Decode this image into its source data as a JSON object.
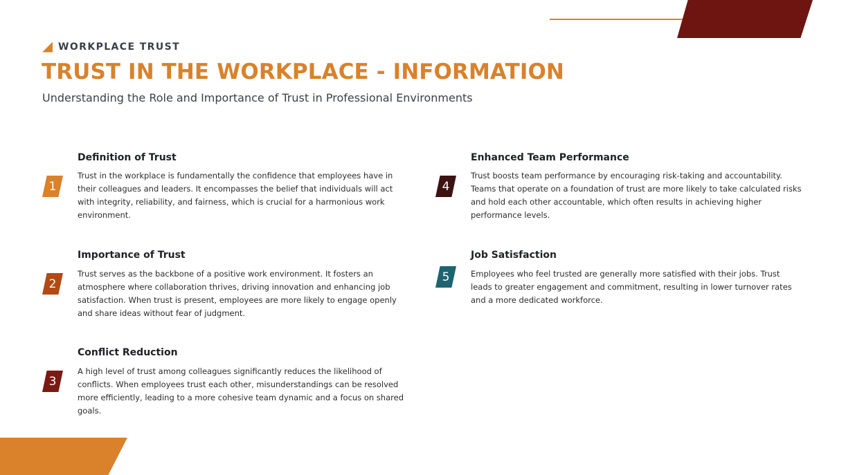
{
  "header": {
    "eyebrow": "WORKPLACE TRUST",
    "title": "TRUST IN THE WORKPLACE - INFORMATION",
    "subtitle": "Understanding the Role and Importance of Trust in Professional Environments"
  },
  "colors": {
    "orange": "#d9822b",
    "dark_red": "#6e1511",
    "rust": "#b24a14",
    "maroon": "#7a1a14",
    "dark_brown": "#3d1312",
    "teal": "#1d6470"
  },
  "items": [
    {
      "number": "1",
      "heading": "Definition of Trust",
      "body": "Trust in the workplace is fundamentally the confidence that employees have in their colleagues and leaders. It encompasses the belief that individuals will act with integrity, reliability, and fairness, which is crucial for a harmonious work environment."
    },
    {
      "number": "2",
      "heading": "Importance of Trust",
      "body": "Trust serves as the backbone of a positive work environment. It fosters an atmosphere where collaboration thrives, driving innovation and enhancing job satisfaction. When trust is present, employees are more likely to engage openly and share ideas without fear of judgment."
    },
    {
      "number": "3",
      "heading": "Conflict Reduction",
      "body": "A high level of trust among colleagues significantly reduces the likelihood of conflicts. When employees trust each other, misunderstandings can be resolved more efficiently, leading to a more cohesive team dynamic and a focus on shared goals."
    },
    {
      "number": "4",
      "heading": "Enhanced Team Performance",
      "body": "Trust boosts team performance by encouraging risk-taking and accountability. Teams that operate on a foundation of trust are more likely to take calculated risks and hold each other accountable, which often results in achieving higher performance levels."
    },
    {
      "number": "5",
      "heading": "Job Satisfaction",
      "body": "Employees who feel trusted are generally more satisfied with their jobs. Trust leads to greater engagement and commitment, resulting in lower turnover rates and a more dedicated workforce."
    }
  ]
}
